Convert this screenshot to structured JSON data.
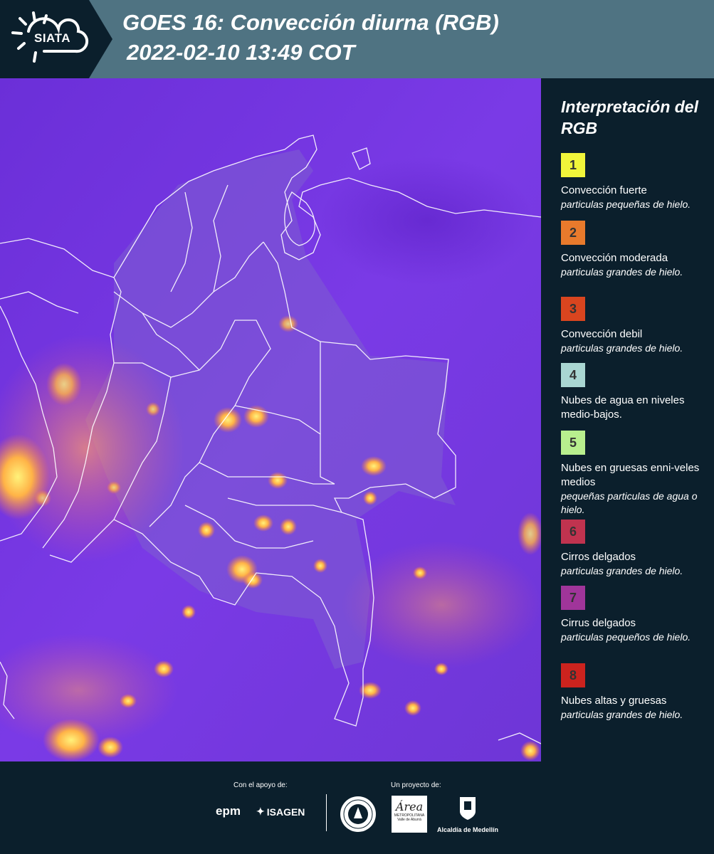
{
  "header": {
    "logo_text": "SIATA",
    "title_line1": "GOES 16: Convección diurna (RGB)",
    "title_line2": "2022-02-10 13:49 COT"
  },
  "legend": {
    "title": "Interpretación del RGB",
    "items": [
      {
        "number": "1",
        "color": "#f1f53a",
        "name": "Convección fuerte",
        "desc": "particulas pequeñas de hielo."
      },
      {
        "number": "2",
        "color": "#e87a2c",
        "name": "Convección moderada",
        "desc": "particulas grandes de hielo."
      },
      {
        "number": "3",
        "color": "#d9451f",
        "name": "Convección debil",
        "desc": "particulas grandes de hielo."
      },
      {
        "number": "4",
        "color": "#a9d6d2",
        "name": "Nubes de agua en niveles medio-bajos.",
        "desc": ""
      },
      {
        "number": "5",
        "color": "#b8ef8e",
        "name": "Nubes en gruesas enni-veles medios",
        "desc": "pequeñas particulas de agua o hielo."
      },
      {
        "number": "6",
        "color": "#c0334f",
        "name": "Cirros delgados",
        "desc": "particulas grandes de hielo."
      },
      {
        "number": "7",
        "color": "#a0359a",
        "name": "Cirrus delgados",
        "desc": "particulas pequeños de hielo."
      },
      {
        "number": "8",
        "color": "#cc231e",
        "name": "Nubes altas y gruesas",
        "desc": "particulas grandes de hielo."
      }
    ]
  },
  "footer": {
    "support_label": "Con el apoyo de:",
    "project_label": "Un proyecto de:",
    "epm": "epm",
    "isagen": "ISAGEN",
    "area_logo_word": "Área",
    "area_logo_sub": "METROPOLITANA Valle de Aburrá",
    "medellin": "Alcaldía de Medellín"
  },
  "colors": {
    "header_bg": "#4f7382",
    "logo_bg": "#0b1f2c",
    "page_bg": "#0b1f2c",
    "map_base": "#6a2ae0"
  }
}
